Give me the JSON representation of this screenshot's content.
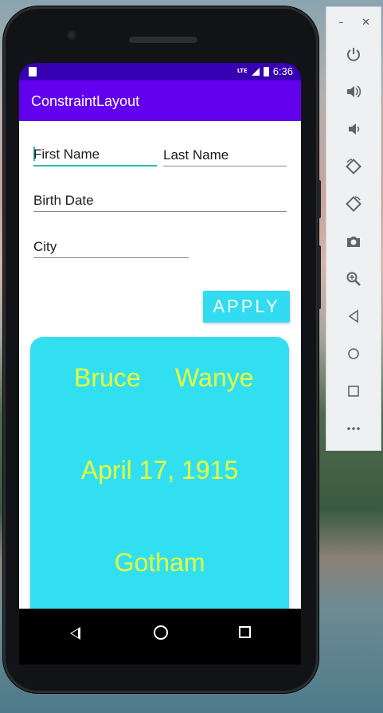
{
  "status_bar": {
    "time": "6:36",
    "network": "LTE"
  },
  "app_bar": {
    "title": "ConstraintLayout"
  },
  "form": {
    "first_name_placeholder": "First Name",
    "last_name_placeholder": "Last Name",
    "birth_date_placeholder": "Birth Date",
    "city_placeholder": "City",
    "apply_label": "APPLY"
  },
  "card": {
    "first_name": "Bruce",
    "last_name": "Wanye",
    "birth_date": "April 17, 1915",
    "city": "Gotham"
  },
  "colors": {
    "app_bar": "#6200ee",
    "status_bar": "#3700b3",
    "accent": "#31dcf0",
    "card_text": "#e8ff3a",
    "focus_line": "#26bfa8"
  },
  "emulator_toolbar": {
    "window_controls": [
      "minimize-icon",
      "close-icon"
    ],
    "buttons": [
      "power-icon",
      "volume-up-icon",
      "volume-down-icon",
      "rotate-left-icon",
      "rotate-right-icon",
      "camera-icon",
      "zoom-icon",
      "back-icon",
      "home-icon",
      "overview-icon",
      "more-icon"
    ]
  }
}
